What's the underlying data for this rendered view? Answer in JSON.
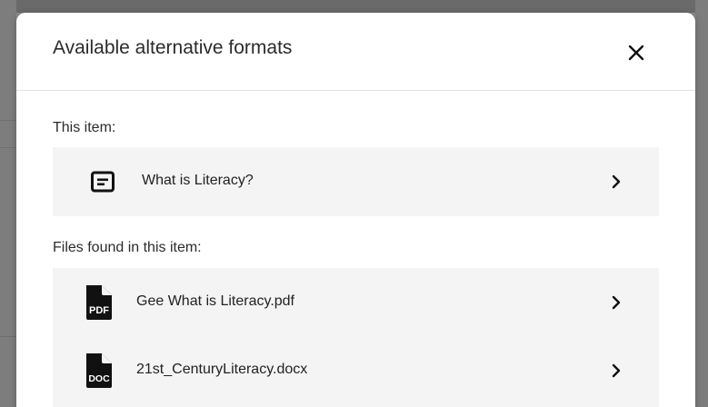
{
  "modal": {
    "title": "Available alternative formats",
    "close_label": "Close"
  },
  "this_item": {
    "heading": "This item:",
    "item": {
      "label": "What is Literacy?",
      "icon": "document-icon"
    }
  },
  "files": {
    "heading": "Files found in this item:",
    "items": [
      {
        "label": "Gee What is Literacy.pdf",
        "icon": "pdf-file-icon",
        "badge": "PDF"
      },
      {
        "label": "21st_CenturyLiteracy.docx",
        "icon": "doc-file-icon",
        "badge": "DOC"
      }
    ]
  },
  "colors": {
    "row_background": "#f4f4f4",
    "text": "#222222",
    "divider": "#e3e3e3"
  }
}
